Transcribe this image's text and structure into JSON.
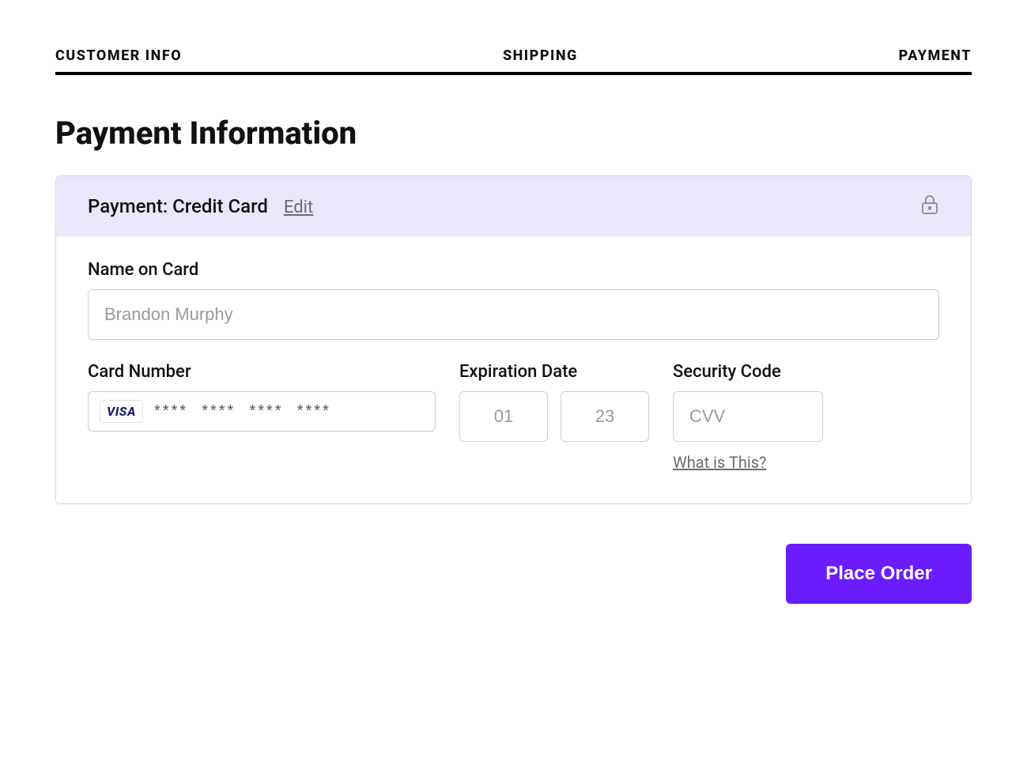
{
  "steps": {
    "customer_info": "CUSTOMER INFO",
    "shipping": "SHIPPING",
    "payment": "PAYMENT"
  },
  "page_title": "Payment Information",
  "panel": {
    "header_label": "Payment: Credit Card",
    "edit_label": "Edit"
  },
  "form": {
    "name_label": "Name on Card",
    "name_placeholder": "Brandon Murphy",
    "cardnum_label": "Card Number",
    "cardnum_placeholder": "****  ****  ****  ****",
    "card_brand": "VISA",
    "exp_label": "Expiration Date",
    "exp_month_placeholder": "01",
    "exp_year_placeholder": "23",
    "cvv_label": "Security Code",
    "cvv_placeholder": "CVV",
    "cvv_help": "What is This?"
  },
  "actions": {
    "place_order": "Place Order"
  }
}
